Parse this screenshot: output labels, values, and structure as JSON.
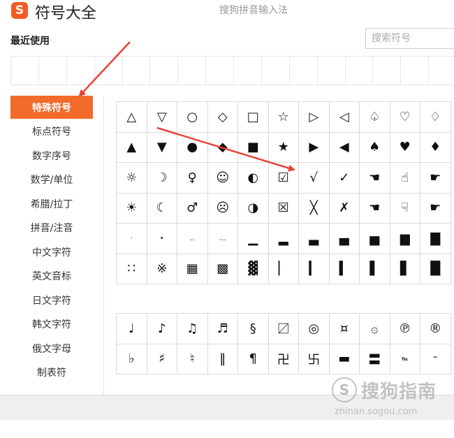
{
  "header": {
    "logo_glyph": "S",
    "title": "符号大全",
    "subtitle": "搜狗拼音输入法"
  },
  "recent": {
    "label": "最近使用"
  },
  "search": {
    "placeholder": "搜索符号"
  },
  "sidebar": {
    "items": [
      {
        "label": "特殊符号",
        "active": true
      },
      {
        "label": "标点符号"
      },
      {
        "label": "数字序号"
      },
      {
        "label": "数学/单位"
      },
      {
        "label": "希腊/拉丁"
      },
      {
        "label": "拼音/注音"
      },
      {
        "label": "中文字符"
      },
      {
        "label": "英文音标"
      },
      {
        "label": "日文字符"
      },
      {
        "label": "韩文字符"
      },
      {
        "label": "俄文字母"
      },
      {
        "label": "制表符"
      }
    ]
  },
  "symbols": {
    "grid1": [
      [
        "△",
        "▽",
        "○",
        "◇",
        "□",
        "☆",
        "▷",
        "◁",
        "♤",
        "♡",
        "♢"
      ],
      [
        "▲",
        "▼",
        "●",
        "◆",
        "■",
        "★",
        "▶",
        "◀",
        "♠",
        "♥",
        "♦"
      ],
      [
        "☼",
        "☽",
        "♀",
        "☺",
        "◐",
        "☑",
        "√",
        "✓",
        "☚",
        "☝",
        "☛"
      ],
      [
        "☀",
        "☾",
        "♂",
        "☹",
        "◑",
        "☒",
        "╳",
        "✗",
        "☚",
        "☟",
        "☛"
      ],
      [
        "·",
        "•",
        "‥",
        "…",
        "▁",
        "▂",
        "▃",
        "▄",
        "▅",
        "▆",
        "▇"
      ],
      [
        "∷",
        "※",
        "▦",
        "▩",
        "▓",
        "▏",
        "▎",
        "▍",
        "▌",
        "▋",
        "█"
      ]
    ],
    "grid2": [
      [
        "♩",
        "♪",
        "♫",
        "♬",
        "§",
        "〼",
        "◎",
        "¤",
        "۞",
        "℗",
        "®"
      ],
      [
        "♭",
        "♯",
        "♮",
        "‖",
        "¶",
        "卍",
        "卐",
        "▬",
        "〓",
        "℡",
        "™"
      ]
    ]
  },
  "watermark": {
    "mark": "S",
    "text": "搜狗指南",
    "url": "zhinan.sogou.com"
  },
  "colors": {
    "accent": "#f26b2a",
    "arrow": "#e8423a"
  }
}
